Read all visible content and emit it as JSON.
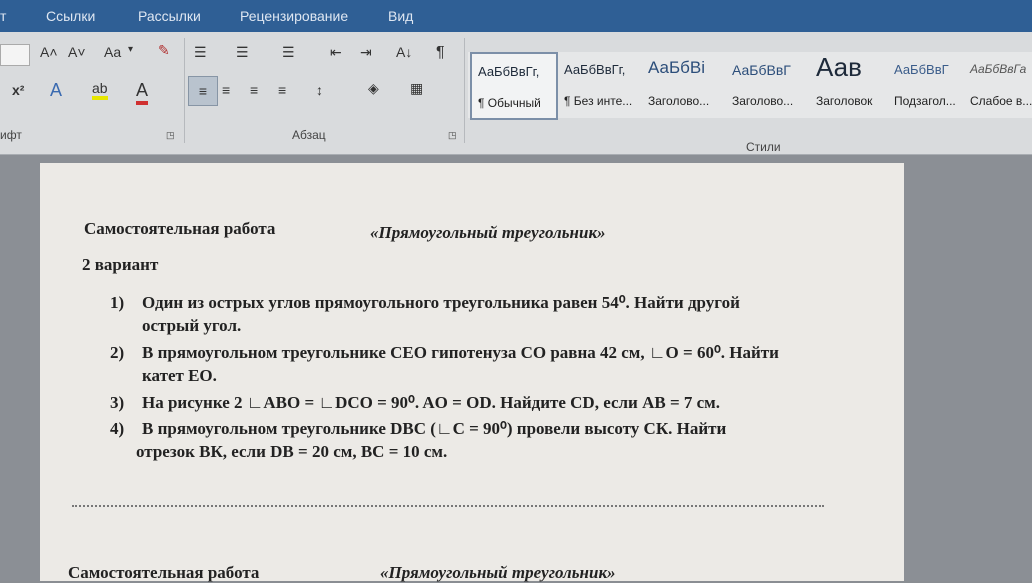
{
  "tabs": [
    "т",
    "Ссылки",
    "Рассылки",
    "Рецензирование",
    "Вид"
  ],
  "ribbon": {
    "row1": {
      "grow_font": "A˄",
      "shrink_font": "A˅",
      "change_case": "Aa",
      "case_arrow": "▾",
      "clear": "✎",
      "bullets": "☰",
      "numbering": "☰",
      "multilevel": "☰",
      "decrease_indent": "⇤",
      "increase_indent": "⇥",
      "sort": "A↓",
      "pilcrow": "¶"
    },
    "row2": {
      "superscript": "x²",
      "text_effects": "A",
      "highlight": "ab",
      "font_color": "A",
      "align_left": "≡",
      "align_center": "≡",
      "align_right": "≡",
      "justify": "≡",
      "line_spacing": "↕",
      "shading": "◈",
      "borders": "▦"
    },
    "groups": {
      "font": "ифт",
      "paragraph": "Абзац",
      "styles": "Стили"
    },
    "styles": [
      {
        "sample": "АаБбВвГг,",
        "name": "¶ Обычный"
      },
      {
        "sample": "АаБбВвГг,",
        "name": "¶ Без инте..."
      },
      {
        "sample": "АаБбВі",
        "name": "Заголово..."
      },
      {
        "sample": "АаБбВвГ",
        "name": "Заголово..."
      },
      {
        "sample": "Аав",
        "name": "Заголовок"
      },
      {
        "sample": "АаБбВвГ",
        "name": "Подзагол..."
      },
      {
        "sample": "АаБбВвГа",
        "name": "Слабое в..."
      }
    ]
  },
  "document": {
    "title": "Самостоятельная работа",
    "subtitle": "«Прямоугольный треугольник»",
    "variant": "2 вариант",
    "items": [
      {
        "num": "1)",
        "lines": [
          "Один из острых углов прямоугольного треугольника равен 54⁰. Найти другой",
          "острый угол."
        ]
      },
      {
        "num": "2)",
        "lines": [
          "В прямоугольном треугольнике СЕО гипотенуза СО равна 42 см, ∟О = 60⁰. Найти",
          "катет ЕО."
        ]
      },
      {
        "num": "3)",
        "lines": [
          "На рисунке 2 ∟АВО = ∟DCO = 90⁰. AO = OD. Найдите CD, если AB = 7 см."
        ]
      },
      {
        "num": "4)",
        "lines": [
          "В прямоугольном треугольнике DBC (∟C = 90⁰) провели высоту СК. Найти",
          "отрезок ВК, если DB = 20 см, BC = 10 см."
        ]
      }
    ],
    "next_title": "Самостоятельная работа",
    "next_subtitle": "«Прямоугольный треугольник»"
  }
}
